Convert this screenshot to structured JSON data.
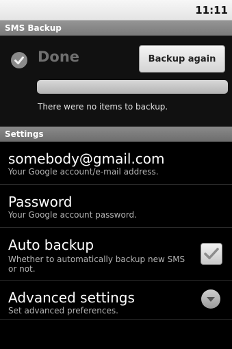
{
  "status_bar": {
    "time": "11:11"
  },
  "app": {
    "title": "SMS Backup"
  },
  "backup": {
    "status": "Done",
    "button_label": "Backup again",
    "progress_fraction": 0,
    "message": "There were no items to backup."
  },
  "settings": {
    "header": "Settings",
    "account": {
      "title": "somebody@gmail.com",
      "summary": "Your Google account/e-mail address."
    },
    "password": {
      "title": "Password",
      "summary": "Your Google account password."
    },
    "auto_backup": {
      "title": "Auto backup",
      "summary": "Whether to automatically backup new SMS or not.",
      "checked": true
    },
    "advanced": {
      "title": "Advanced settings",
      "summary": "Set advanced preferences."
    }
  },
  "icons": {
    "done": "check-circle-icon",
    "checkbox": "check-icon",
    "expand": "chevron-down-icon"
  },
  "colors": {
    "accent": "#ffcc33",
    "background": "#000000",
    "header": "#7a7a7a"
  }
}
